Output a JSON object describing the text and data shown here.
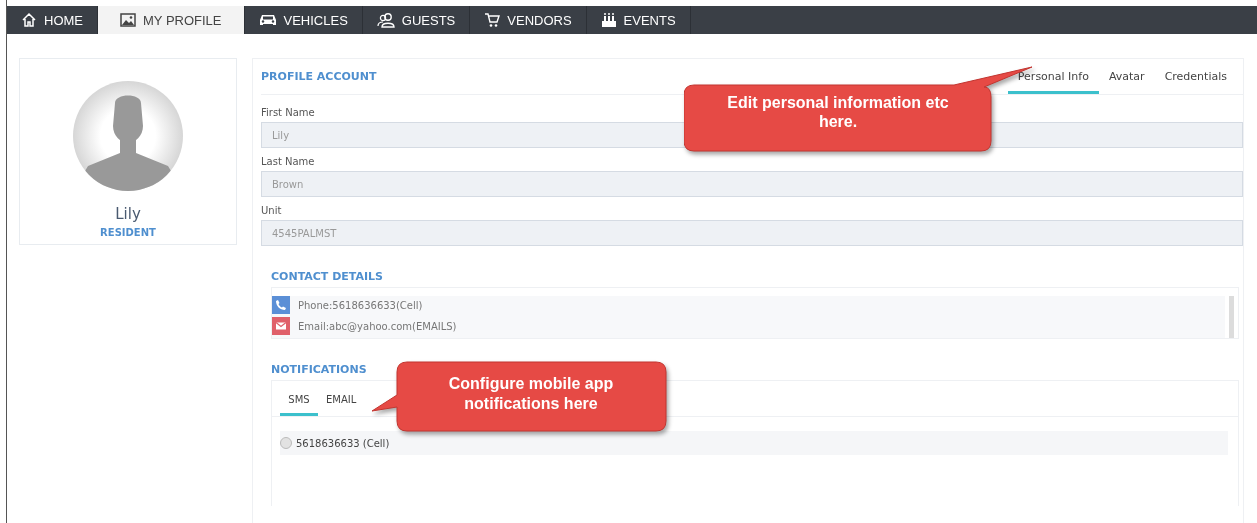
{
  "nav_tabs": [
    {
      "label": "HOME",
      "kind": "home",
      "selected": false
    },
    {
      "label": "MY PROFILE",
      "kind": "image",
      "selected": true
    },
    {
      "label": "VEHICLES",
      "kind": "car",
      "selected": false
    },
    {
      "label": "GUESTS",
      "kind": "people",
      "selected": false
    },
    {
      "label": "VENDORS",
      "kind": "cart",
      "selected": false
    },
    {
      "label": "EVENTS",
      "kind": "cake",
      "selected": false
    }
  ],
  "profile_card": {
    "name": "Lily",
    "role": "RESIDENT"
  },
  "profile_account": {
    "title": "PROFILE ACCOUNT",
    "tabs": [
      {
        "label": "Personal Info",
        "selected": true
      },
      {
        "label": "Avatar",
        "selected": false
      },
      {
        "label": "Credentials",
        "selected": false
      }
    ],
    "fields": [
      {
        "label": "First Name",
        "value": "Lily"
      },
      {
        "label": "Last Name",
        "value": "Brown"
      },
      {
        "label": "Unit",
        "value": "4545PALMST"
      }
    ]
  },
  "contact_details": {
    "title": "CONTACT DETAILS",
    "items": [
      {
        "kind": "phone",
        "text": "Phone:5618636633(Cell)"
      },
      {
        "kind": "email",
        "text": "Email:abc@yahoo.com(EMAILS)"
      }
    ]
  },
  "notifications": {
    "title": "NOTIFICATIONS",
    "tabs": [
      {
        "label": "SMS",
        "selected": true
      },
      {
        "label": "EMAIL",
        "selected": false
      }
    ],
    "options": [
      {
        "label": "5618636633 (Cell)",
        "selected": false
      }
    ]
  },
  "callouts": [
    {
      "kind": "top-right",
      "text": "Edit personal information etc here."
    },
    {
      "kind": "left",
      "text": "Configure mobile app notifications here"
    }
  ]
}
